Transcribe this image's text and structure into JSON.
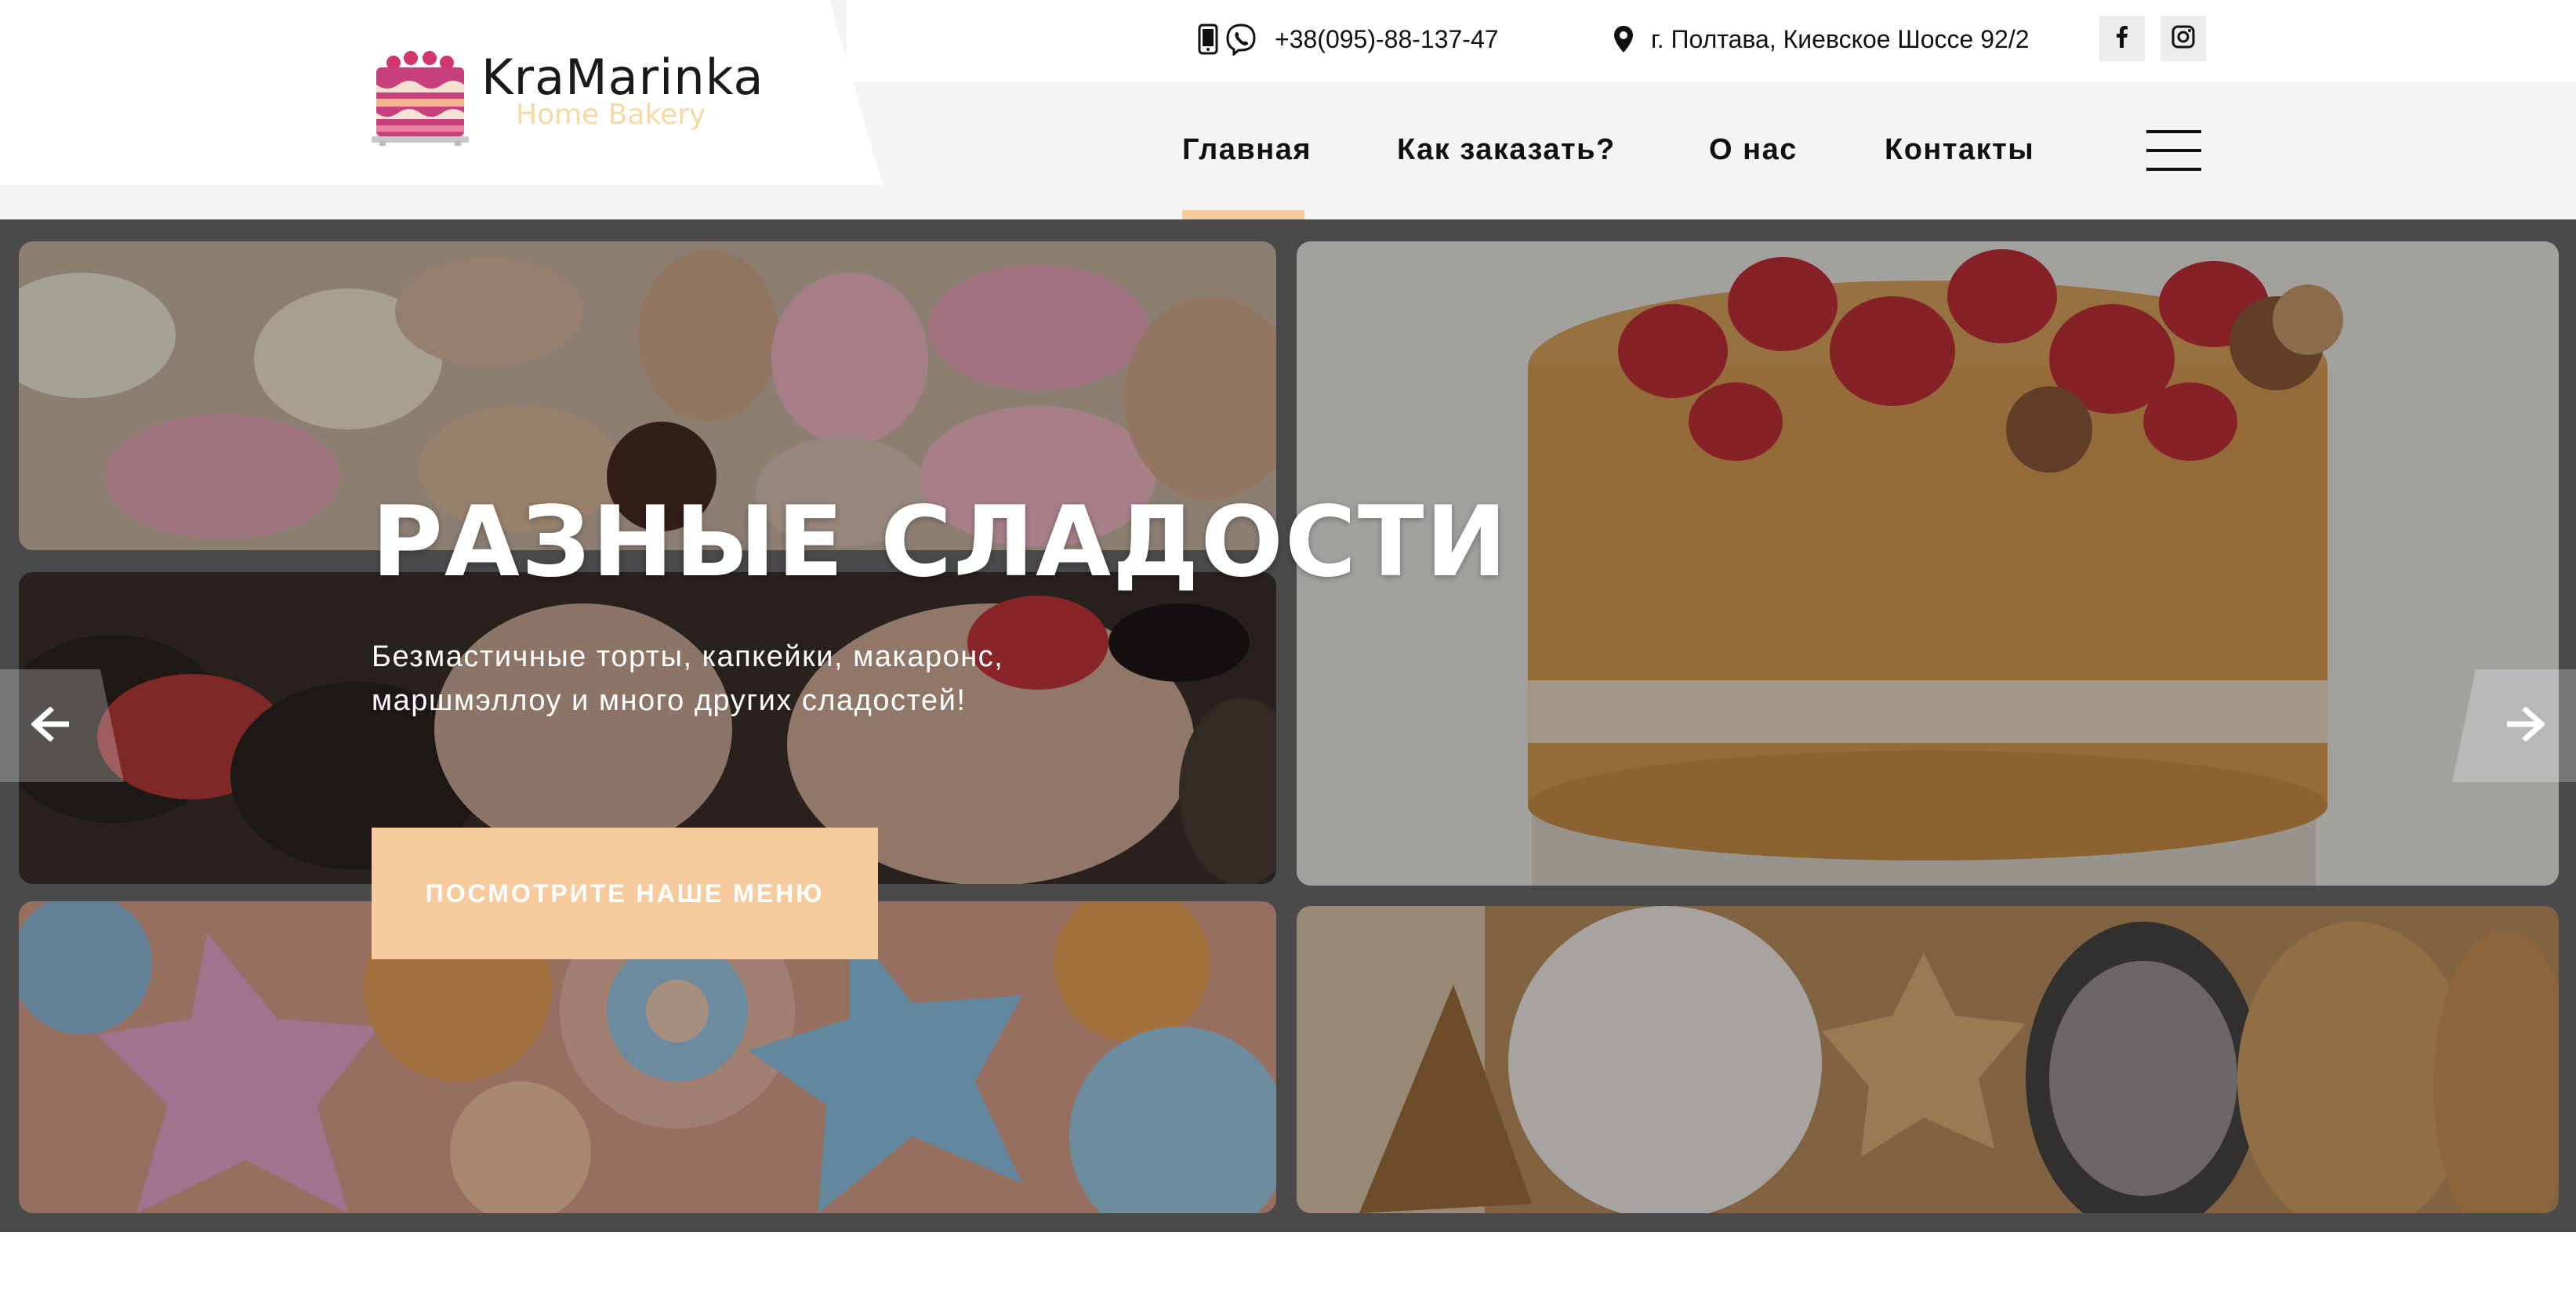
{
  "brand": {
    "name": "KraMarinka",
    "tagline": "Home Bakery",
    "logo_icon": "cake-icon",
    "accent_color": "#f8cb9f"
  },
  "topbar": {
    "phone": "+38(095)-88-137-47",
    "phone_icons": [
      "mobile-phone-icon",
      "viber-icon"
    ],
    "address": "г. Полтава, Киевское Шоссе 92/2",
    "address_icon": "map-pin-icon",
    "social": [
      "facebook-icon",
      "instagram-icon"
    ]
  },
  "nav": {
    "items": [
      {
        "label": "Главная",
        "active": true
      },
      {
        "label": "Как заказать?",
        "active": false
      },
      {
        "label": "О нас",
        "active": false
      },
      {
        "label": "Контакты",
        "active": false
      }
    ],
    "menu_icon": "hamburger-menu-icon"
  },
  "hero": {
    "title": "РАЗНЫЕ СЛАДОСТИ",
    "description": "Безмастичные торты, капкейки, макаронс, маршмэллоу и много других сладостей!",
    "cta_label": "ПОСМОТРИТЕ НАШЕ МЕНЮ",
    "images": [
      "macarons-photo",
      "cupcakes-photo",
      "marshmallow-sea-creatures-photo",
      "strawberry-cake-photo",
      "cookies-box-photo"
    ],
    "prev_icon": "arrow-left-icon",
    "next_icon": "arrow-right-icon"
  }
}
